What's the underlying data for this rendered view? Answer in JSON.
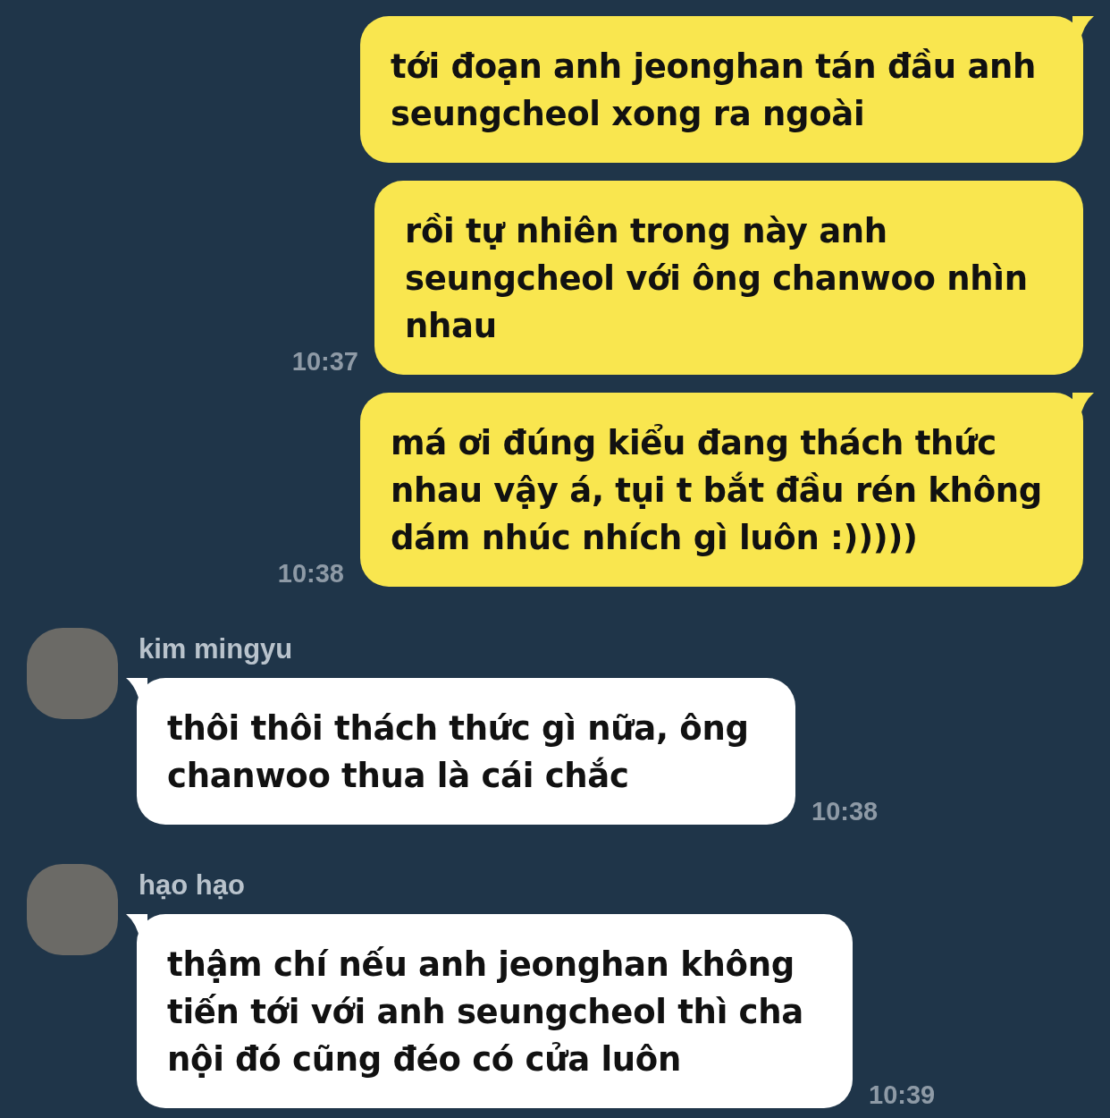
{
  "messages": [
    {
      "kind": "sent",
      "tail": true,
      "text": "tới đoạn anh jeonghan tán đầu anh seungcheol xong ra ngoài"
    },
    {
      "kind": "sent",
      "tail": false,
      "text": "rồi tự nhiên trong này anh seungcheol với ông chanwoo nhìn nhau",
      "time": "10:37"
    },
    {
      "kind": "sent",
      "tail": true,
      "text": "má ơi đúng kiểu đang thách thức nhau vậy á, tụi t bắt đầu rén không dám nhúc nhích gì luôn :)))))",
      "time": "10:38"
    },
    {
      "kind": "received",
      "tail": true,
      "sender": "kim mingyu",
      "text": "thôi thôi thách thức gì nữa, ông chanwoo thua là cái chắc",
      "time": "10:38"
    },
    {
      "kind": "received",
      "tail": true,
      "sender": "hạo hạo",
      "text": "thậm chí nếu anh jeonghan không tiến tới với anh seungcheol thì cha nội đó cũng đéo có cửa luôn",
      "time": "10:39"
    }
  ]
}
